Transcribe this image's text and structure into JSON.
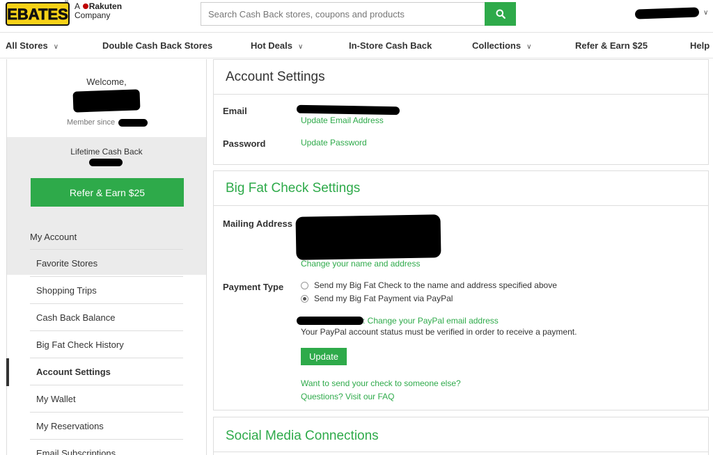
{
  "brand": {
    "logo_text": "EBATES",
    "tm": "®",
    "company_prefix": "A",
    "company_name": "Rakuten",
    "company_suffix": "Company",
    "colors": {
      "accent": "#2eaa4a",
      "logo_yellow": "#f7d117",
      "rakuten_red": "#bf0000"
    }
  },
  "search": {
    "placeholder": "Search Cash Back stores, coupons and products",
    "icon": "search-icon"
  },
  "nav": {
    "items": [
      {
        "label": "All Stores",
        "has_dropdown": true
      },
      {
        "label": "Double Cash Back Stores",
        "has_dropdown": false
      },
      {
        "label": "Hot Deals",
        "has_dropdown": true
      },
      {
        "label": "In-Store Cash Back",
        "has_dropdown": false
      },
      {
        "label": "Collections",
        "has_dropdown": true
      },
      {
        "label": "Refer & Earn $25",
        "has_dropdown": false
      },
      {
        "label": "Help",
        "has_dropdown": false
      }
    ]
  },
  "sidebar": {
    "welcome": "Welcome,",
    "member_since": "Member since",
    "lifetime_label": "Lifetime Cash Back",
    "refer_button": "Refer & Earn $25",
    "menu_title": "My Account",
    "menu": [
      {
        "label": "Favorite Stores",
        "active": false
      },
      {
        "label": "Shopping Trips",
        "active": false
      },
      {
        "label": "Cash Back Balance",
        "active": false
      },
      {
        "label": "Big Fat Check History",
        "active": false
      },
      {
        "label": "Account Settings",
        "active": true
      },
      {
        "label": "My Wallet",
        "active": false
      },
      {
        "label": "My Reservations",
        "active": false
      },
      {
        "label": "Email Subscriptions",
        "active": false
      }
    ]
  },
  "account": {
    "title": "Account Settings",
    "email_label": "Email",
    "email_link": "Update Email Address",
    "password_label": "Password",
    "password_link": "Update Password"
  },
  "check": {
    "title": "Big Fat Check Settings",
    "mailing_label": "Mailing Address",
    "mailing_link": "Change your name and address",
    "payment_label": "Payment Type",
    "option_check": "Send my Big Fat Check to the name and address specified above",
    "option_paypal": "Send my Big Fat Payment via PayPal",
    "selected": "paypal",
    "paypal_link": ": Change your PayPal email address",
    "paypal_note": "Your PayPal account status must be verified in order to receive a payment.",
    "update_button": "Update",
    "send_link": "Want to send your check to someone else?",
    "faq_link": "Questions? Visit our FAQ"
  },
  "social": {
    "title": "Social Media Connections"
  }
}
